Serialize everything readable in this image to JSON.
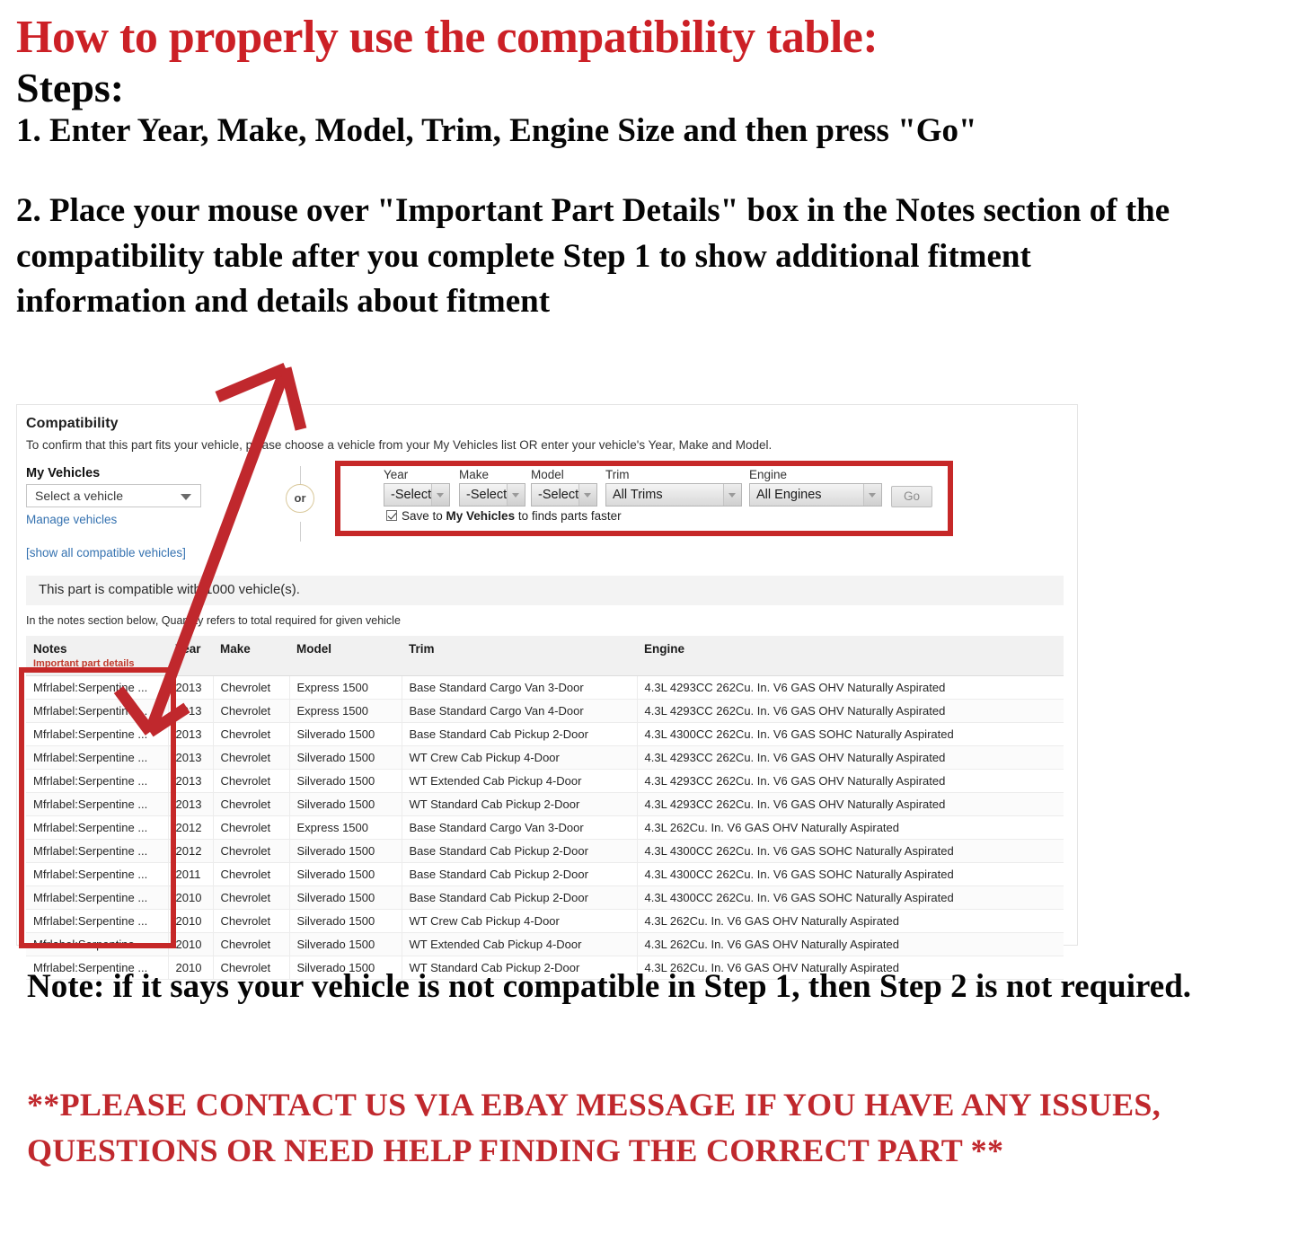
{
  "header": {
    "title": "How to properly use the compatibility table:",
    "steps_label": "Steps:",
    "step1": "1. Enter Year, Make, Model, Trim, Engine Size and then press \"Go\"",
    "step2": "2. Place your mouse over \"Important Part Details\" box in the Notes section of the compatibility table after you complete Step 1 to show additional fitment information and details about fitment"
  },
  "footer": {
    "note": "Note: if it says your vehicle is not compatible in Step 1, then Step 2 is not required.",
    "contact": "**PLEASE CONTACT US VIA EBAY MESSAGE IF YOU HAVE ANY ISSUES, QUESTIONS OR NEED HELP FINDING THE CORRECT PART **"
  },
  "compatibility": {
    "heading": "Compatibility",
    "subtext": "To confirm that this part fits your vehicle, please choose a vehicle from your My Vehicles list OR enter your vehicle's Year, Make and Model.",
    "my_vehicles_label": "My Vehicles",
    "vehicle_select_value": "Select a vehicle",
    "manage_vehicles_link": "Manage vehicles",
    "show_all_link": "[show all compatible vehicles]",
    "or_divider": "or",
    "count_text": "This part is compatible with 1000 vehicle(s).",
    "qty_note": "In the notes section below, Quantity refers to total required for given vehicle",
    "accent_red": "#c62828",
    "link_blue": "#3572b0",
    "fields": [
      {
        "label": "Year",
        "value": "-Select-"
      },
      {
        "label": "Make",
        "value": "-Select-"
      },
      {
        "label": "Model",
        "value": "-Select-"
      },
      {
        "label": "Trim",
        "value": "All Trims"
      },
      {
        "label": "Engine",
        "value": "All Engines"
      }
    ],
    "go_button": "Go",
    "save_checkbox": {
      "checked": true,
      "prefix": "Save to ",
      "strong": "My Vehicles",
      "suffix": " to finds parts faster"
    }
  },
  "table": {
    "columns": [
      {
        "key": "notes",
        "label": "Notes",
        "sublabel": "Important part details"
      },
      {
        "key": "year",
        "label": "Year"
      },
      {
        "key": "make",
        "label": "Make"
      },
      {
        "key": "model",
        "label": "Model"
      },
      {
        "key": "trim",
        "label": "Trim"
      },
      {
        "key": "engine",
        "label": "Engine"
      }
    ],
    "rows": [
      {
        "notes": "Mfrlabel:Serpentine ...",
        "year": "2013",
        "make": "Chevrolet",
        "model": "Express 1500",
        "trim": "Base Standard Cargo Van 3-Door",
        "engine": "4.3L 4293CC 262Cu. In. V6 GAS OHV Naturally Aspirated"
      },
      {
        "notes": "Mfrlabel:Serpentine ...",
        "year": "2013",
        "make": "Chevrolet",
        "model": "Express 1500",
        "trim": "Base Standard Cargo Van 4-Door",
        "engine": "4.3L 4293CC 262Cu. In. V6 GAS OHV Naturally Aspirated"
      },
      {
        "notes": "Mfrlabel:Serpentine ...",
        "year": "2013",
        "make": "Chevrolet",
        "model": "Silverado 1500",
        "trim": "Base Standard Cab Pickup 2-Door",
        "engine": "4.3L 4300CC 262Cu. In. V6 GAS SOHC Naturally Aspirated"
      },
      {
        "notes": "Mfrlabel:Serpentine ...",
        "year": "2013",
        "make": "Chevrolet",
        "model": "Silverado 1500",
        "trim": "WT Crew Cab Pickup 4-Door",
        "engine": "4.3L 4293CC 262Cu. In. V6 GAS OHV Naturally Aspirated"
      },
      {
        "notes": "Mfrlabel:Serpentine ...",
        "year": "2013",
        "make": "Chevrolet",
        "model": "Silverado 1500",
        "trim": "WT Extended Cab Pickup 4-Door",
        "engine": "4.3L 4293CC 262Cu. In. V6 GAS OHV Naturally Aspirated"
      },
      {
        "notes": "Mfrlabel:Serpentine ...",
        "year": "2013",
        "make": "Chevrolet",
        "model": "Silverado 1500",
        "trim": "WT Standard Cab Pickup 2-Door",
        "engine": "4.3L 4293CC 262Cu. In. V6 GAS OHV Naturally Aspirated"
      },
      {
        "notes": "Mfrlabel:Serpentine ...",
        "year": "2012",
        "make": "Chevrolet",
        "model": "Express 1500",
        "trim": "Base Standard Cargo Van 3-Door",
        "engine": "4.3L 262Cu. In. V6 GAS OHV Naturally Aspirated"
      },
      {
        "notes": "Mfrlabel:Serpentine ...",
        "year": "2012",
        "make": "Chevrolet",
        "model": "Silverado 1500",
        "trim": "Base Standard Cab Pickup 2-Door",
        "engine": "4.3L 4300CC 262Cu. In. V6 GAS SOHC Naturally Aspirated"
      },
      {
        "notes": "Mfrlabel:Serpentine ...",
        "year": "2011",
        "make": "Chevrolet",
        "model": "Silverado 1500",
        "trim": "Base Standard Cab Pickup 2-Door",
        "engine": "4.3L 4300CC 262Cu. In. V6 GAS SOHC Naturally Aspirated"
      },
      {
        "notes": "Mfrlabel:Serpentine ...",
        "year": "2010",
        "make": "Chevrolet",
        "model": "Silverado 1500",
        "trim": "Base Standard Cab Pickup 2-Door",
        "engine": "4.3L 4300CC 262Cu. In. V6 GAS SOHC Naturally Aspirated"
      },
      {
        "notes": "Mfrlabel:Serpentine ...",
        "year": "2010",
        "make": "Chevrolet",
        "model": "Silverado 1500",
        "trim": "WT Crew Cab Pickup 4-Door",
        "engine": "4.3L 262Cu. In. V6 GAS OHV Naturally Aspirated"
      },
      {
        "notes": "Mfrlabel:Serpentine ...",
        "year": "2010",
        "make": "Chevrolet",
        "model": "Silverado 1500",
        "trim": "WT Extended Cab Pickup 4-Door",
        "engine": "4.3L 262Cu. In. V6 GAS OHV Naturally Aspirated"
      },
      {
        "notes": "Mfrlabel:Serpentine ...",
        "year": "2010",
        "make": "Chevrolet",
        "model": "Silverado 1500",
        "trim": "WT Standard Cab Pickup 2-Door",
        "engine": "4.3L 262Cu. In. V6 GAS OHV Naturally Aspirated"
      }
    ]
  }
}
